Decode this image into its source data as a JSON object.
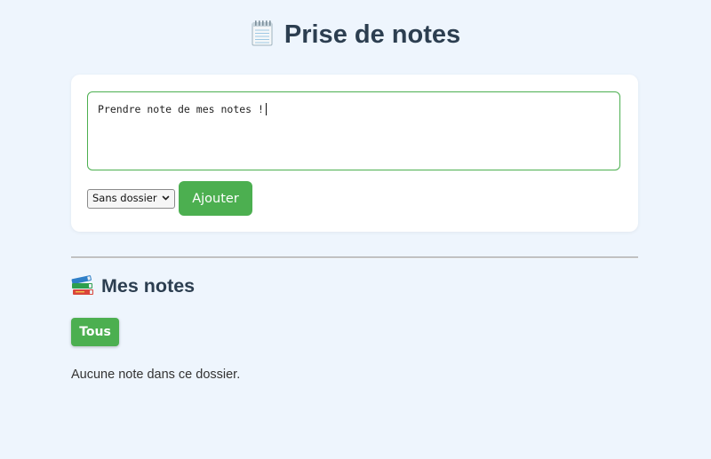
{
  "header": {
    "title": "Prise de notes",
    "icon": "notepad-icon"
  },
  "composer": {
    "note_value": "Prendre note de mes notes !",
    "folder_selected": "Sans dossier",
    "add_label": "Ajouter"
  },
  "notes_section": {
    "title": "Mes notes",
    "icon": "books-icon",
    "filters": [
      {
        "label": "Tous",
        "active": true
      }
    ],
    "empty_message": "Aucune note dans ce dossier."
  },
  "colors": {
    "accent": "#4caf50",
    "background": "#eef5fd",
    "heading": "#2c3e50"
  }
}
